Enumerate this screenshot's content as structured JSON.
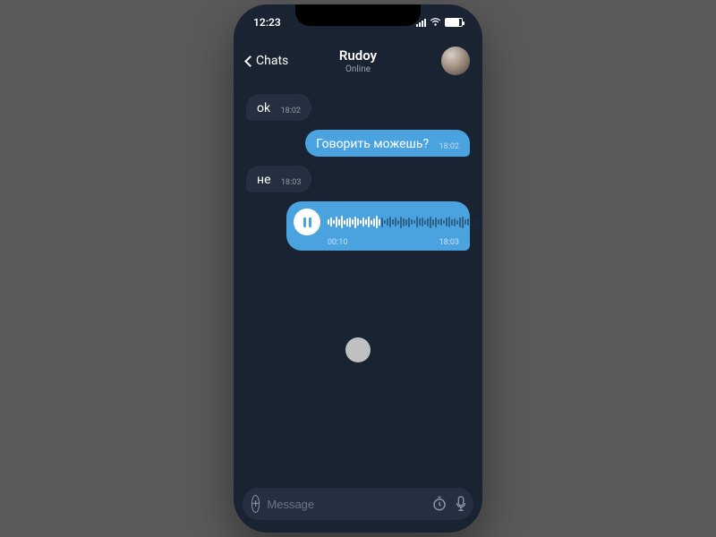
{
  "status_bar": {
    "time": "12:23"
  },
  "header": {
    "back_label": "Chats",
    "contact_name": "Rudoy",
    "contact_status": "Online"
  },
  "messages": [
    {
      "side": "in",
      "type": "text",
      "text": "ok",
      "time": "18:02"
    },
    {
      "side": "out",
      "type": "text",
      "text": "Говорить можешь?",
      "time": "18:02"
    },
    {
      "side": "in",
      "type": "text",
      "text": "не",
      "time": "18:03"
    },
    {
      "side": "out",
      "type": "voice",
      "elapsed": "00:10",
      "time": "18:03"
    }
  ],
  "input": {
    "placeholder": "Message",
    "value": ""
  },
  "colors": {
    "app_bg": "#1a2332",
    "bubble_in": "#252f40",
    "bubble_out": "#4aa3df"
  }
}
